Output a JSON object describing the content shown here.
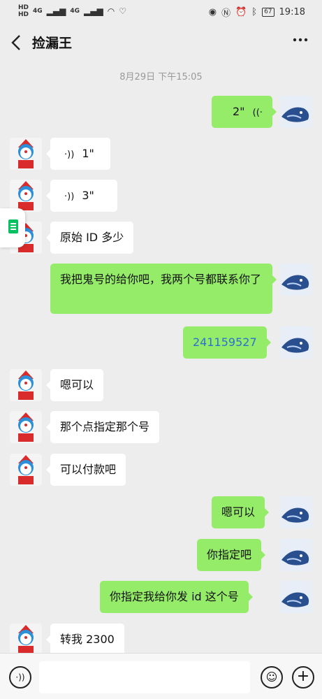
{
  "status_bar": {
    "time": "19:18",
    "battery": "67",
    "signal_1": "HD",
    "signal_2": "HD",
    "net_1": "4G",
    "net_2": "4G"
  },
  "header": {
    "title": "捡漏王"
  },
  "timestamp": "8月29日 下午15:05",
  "messages": [
    {
      "side": "right",
      "type": "voice",
      "text": "2\""
    },
    {
      "side": "left",
      "type": "voice",
      "text": "1\""
    },
    {
      "side": "left",
      "type": "voice",
      "text": "3\""
    },
    {
      "side": "left",
      "type": "text",
      "text": "原始 ID 多少"
    },
    {
      "side": "right",
      "type": "text",
      "text": "我把鬼号的给你吧，我两个号都联系你了"
    },
    {
      "side": "right",
      "type": "text",
      "text": "241159527"
    },
    {
      "side": "left",
      "type": "text",
      "text": "嗯可以"
    },
    {
      "side": "left",
      "type": "text",
      "text": "那个点指定那个号"
    },
    {
      "side": "left",
      "type": "text",
      "text": "可以付款吧"
    },
    {
      "side": "right",
      "type": "text",
      "text": "嗯可以"
    },
    {
      "side": "right",
      "type": "text",
      "text": "你指定吧"
    },
    {
      "side": "right",
      "type": "text",
      "text": "你指定我给你发 id 这个号"
    },
    {
      "side": "left",
      "type": "text",
      "text": "转我 2300"
    }
  ],
  "colors": {
    "outgoing_bubble": "#95ec69",
    "incoming_bubble": "#ffffff",
    "background": "#ededed",
    "link_number": "#2c6fd1"
  },
  "icons": {
    "back": "chevron-left-icon",
    "more": "more-dots-icon",
    "voice": "voice-wave-icon",
    "emoji": "emoji-icon",
    "plus": "plus-icon"
  }
}
